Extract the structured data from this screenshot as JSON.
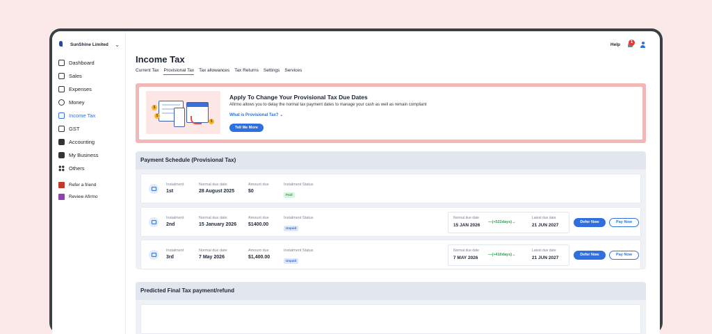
{
  "company": {
    "name": "SunShine Limited"
  },
  "sidebar": {
    "items": [
      {
        "label": "Dashboard",
        "icon": "home-icon"
      },
      {
        "label": "Sales",
        "icon": "chart-icon"
      },
      {
        "label": "Expenses",
        "icon": "receipt-icon"
      },
      {
        "label": "Money",
        "icon": "dollar-icon"
      },
      {
        "label": "Income Tax",
        "icon": "tax-icon",
        "active": true
      },
      {
        "label": "GST",
        "icon": "gst-icon"
      },
      {
        "label": "Accounting",
        "icon": "ledger-icon"
      },
      {
        "label": "My Business",
        "icon": "briefcase-icon"
      },
      {
        "label": "Others",
        "icon": "grid-icon"
      }
    ],
    "extra": [
      {
        "label": "Refer a friend",
        "icon": "gift-icon"
      },
      {
        "label": "Review Afirmo",
        "icon": "star-icon"
      }
    ]
  },
  "header": {
    "help": "Help",
    "notification_count": "1"
  },
  "page": {
    "title": "Income Tax"
  },
  "tabs": [
    "Current Tax",
    "Provisional Tax",
    "Tax allowances",
    "Tax Returns",
    "Settings",
    "Services"
  ],
  "promo": {
    "title": "Apply To Change Your Provisional Tax Due Dates",
    "subtitle": "Afirmo allows you to delay the normal tax payment dates to manage your cash as well as remain compliant",
    "link": "What is Provisional Tax?",
    "button": "Tell Me More"
  },
  "schedule": {
    "title": "Payment Schedule (Provisional Tax)",
    "labels": {
      "instalment": "Instalment",
      "normal_due": "Normal due date",
      "amount": "Amount due",
      "status": "Instalment Status",
      "normal_due_short": "Normal due date",
      "latest_due": "Latest due date"
    },
    "rows": [
      {
        "instalment": "1st",
        "due": "28 August 2025",
        "amount": "$0",
        "status": "Paid"
      },
      {
        "instalment": "2nd",
        "due": "15 January 2026",
        "amount": "$1400.00",
        "status": "Unpaid",
        "normal": "15 JAN 2026",
        "days": "(+522days)",
        "latest": "21 JUN 2027",
        "defer": "Defer Now",
        "pay": "Pay Now"
      },
      {
        "instalment": "3rd",
        "due": "7 May 2026",
        "amount": "$1,400.00",
        "status": "Unpaid",
        "normal": "7 MAY 2026",
        "days": "(+410days)",
        "latest": "21 JUN 2027",
        "defer": "Defer Now",
        "pay": "Pay Now"
      }
    ]
  },
  "predicted": {
    "title": "Predicted Final Tax payment/refund"
  }
}
